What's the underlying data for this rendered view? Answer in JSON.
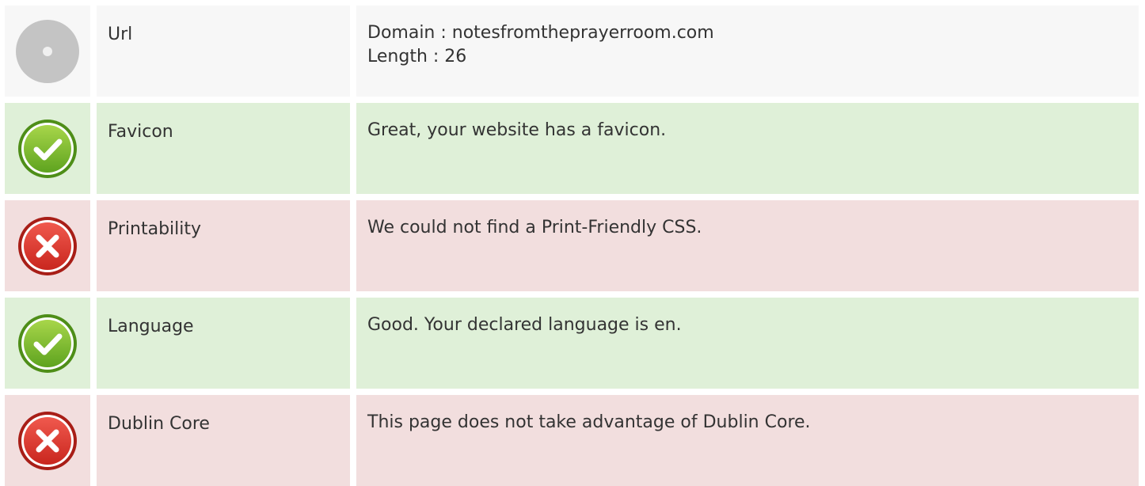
{
  "colors": {
    "neutral_bg": "#f7f7f7",
    "good_bg": "#dff0d8",
    "bad_bg": "#f2dede",
    "good_icon": "#6fb52c",
    "bad_icon": "#d9342b",
    "neutral_icon": "#c4c4c4"
  },
  "rows": [
    {
      "status": "neutral",
      "icon": "info-circle-icon",
      "label": "Url",
      "lines": [
        "Domain : notesfromtheprayerroom.com",
        "Length : 26"
      ]
    },
    {
      "status": "good",
      "icon": "check-circle-icon",
      "label": "Favicon",
      "lines": [
        "Great, your website has a favicon."
      ]
    },
    {
      "status": "bad",
      "icon": "cross-circle-icon",
      "label": "Printability",
      "lines": [
        "We could not find a Print-Friendly CSS."
      ]
    },
    {
      "status": "good",
      "icon": "check-circle-icon",
      "label": "Language",
      "lines": [
        "Good. Your declared language is en."
      ]
    },
    {
      "status": "bad",
      "icon": "cross-circle-icon",
      "label": "Dublin Core",
      "lines": [
        "This page does not take advantage of Dublin Core."
      ]
    }
  ]
}
